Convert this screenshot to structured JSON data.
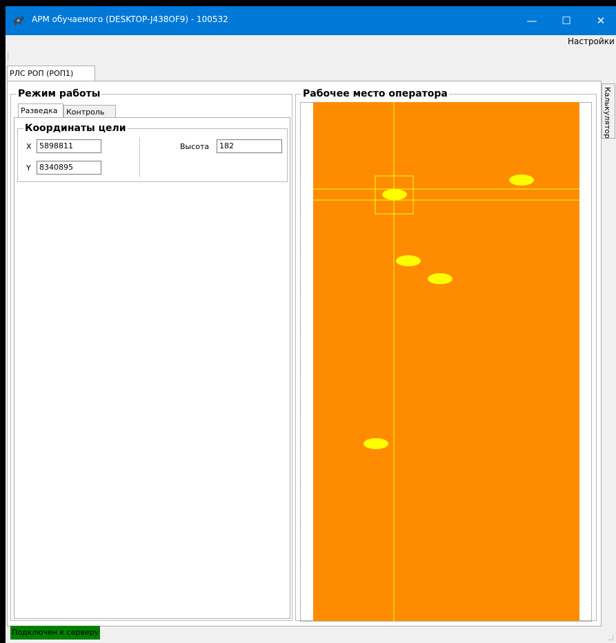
{
  "window": {
    "title": "АРМ обучаемого (DESKTOP-J438OF9) - 100532",
    "minimize_glyph": "—",
    "maximize_glyph": "☐",
    "close_glyph": "✕"
  },
  "menu": {
    "settings_label": "Настройки"
  },
  "main_tab": {
    "label": "РЛС РОП (РОП1)"
  },
  "side_tab": {
    "label": "Калькулятор"
  },
  "mode_panel": {
    "title": "Режим работы",
    "tabs": [
      {
        "label": "Разведка",
        "active": true
      },
      {
        "label": "Контроль",
        "active": false
      }
    ],
    "coords": {
      "title": "Координаты цели",
      "x_label": "X",
      "x_value": "5898811",
      "y_label": "Y",
      "y_value": "8340895",
      "height_label": "Высота",
      "height_value": "182"
    }
  },
  "operator_panel": {
    "title": "Рабочее место оператора",
    "background_color": "#ff8c00",
    "crosshair_color": "#ffff00",
    "target_color": "#ffff00"
  },
  "status": {
    "text": "Подключен к серверу",
    "color": "#008000"
  },
  "icons": [
    "app-icon",
    "minimize-icon",
    "maximize-icon",
    "close-icon",
    "size-grip-icon"
  ]
}
